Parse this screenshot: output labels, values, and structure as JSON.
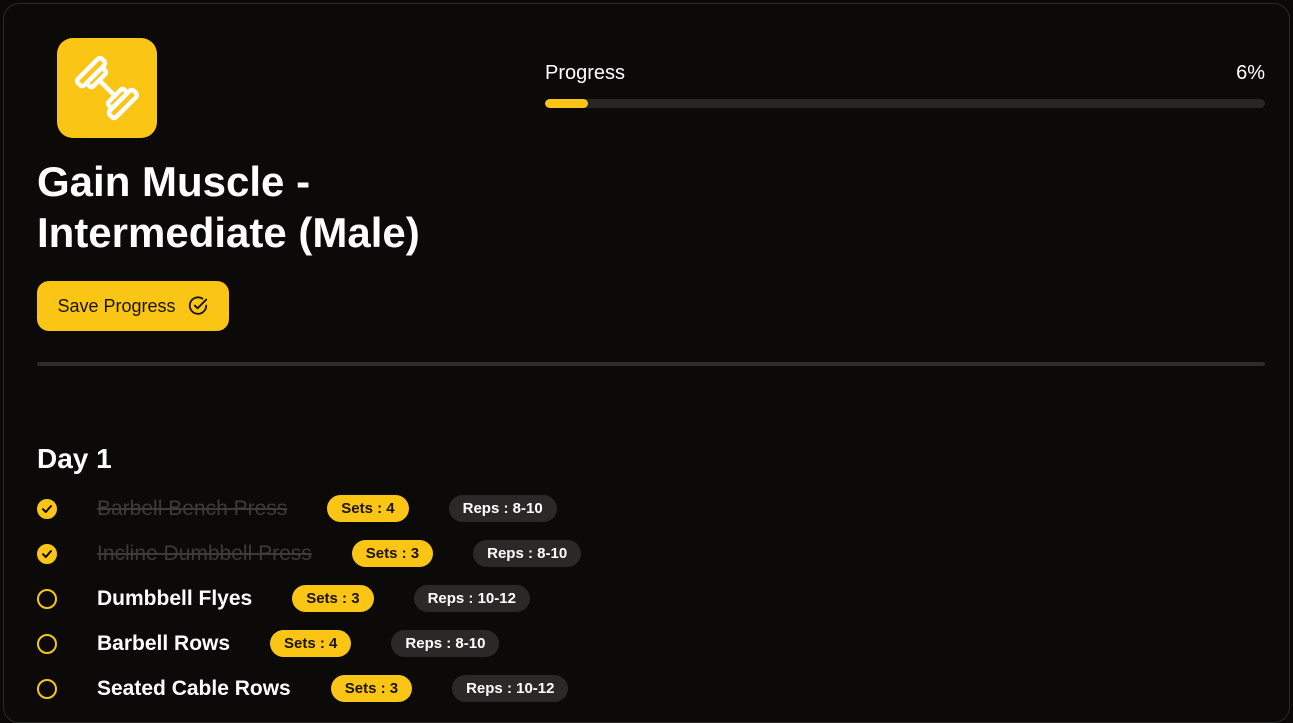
{
  "app": {
    "logo_icon": "dumbbell-icon",
    "accent_color": "#fac515"
  },
  "plan": {
    "title": "Gain Muscle - Intermediate (Male)",
    "save_label": "Save Progress",
    "save_icon": "check-circle-icon"
  },
  "progress": {
    "label": "Progress",
    "percent_text": "6%",
    "value": 6
  },
  "day": {
    "title": "Day 1",
    "exercises": [
      {
        "name": "Barbell Bench Press",
        "sets": "Sets : 4",
        "reps": "Reps : 8-10",
        "done": true
      },
      {
        "name": "Incline Dumbbell Press",
        "sets": "Sets : 3",
        "reps": "Reps : 8-10",
        "done": true
      },
      {
        "name": "Dumbbell Flyes",
        "sets": "Sets : 3",
        "reps": "Reps : 10-12",
        "done": false
      },
      {
        "name": "Barbell Rows",
        "sets": "Sets : 4",
        "reps": "Reps : 8-10",
        "done": false
      },
      {
        "name": "Seated Cable Rows",
        "sets": "Sets : 3",
        "reps": "Reps : 10-12",
        "done": false
      }
    ]
  }
}
